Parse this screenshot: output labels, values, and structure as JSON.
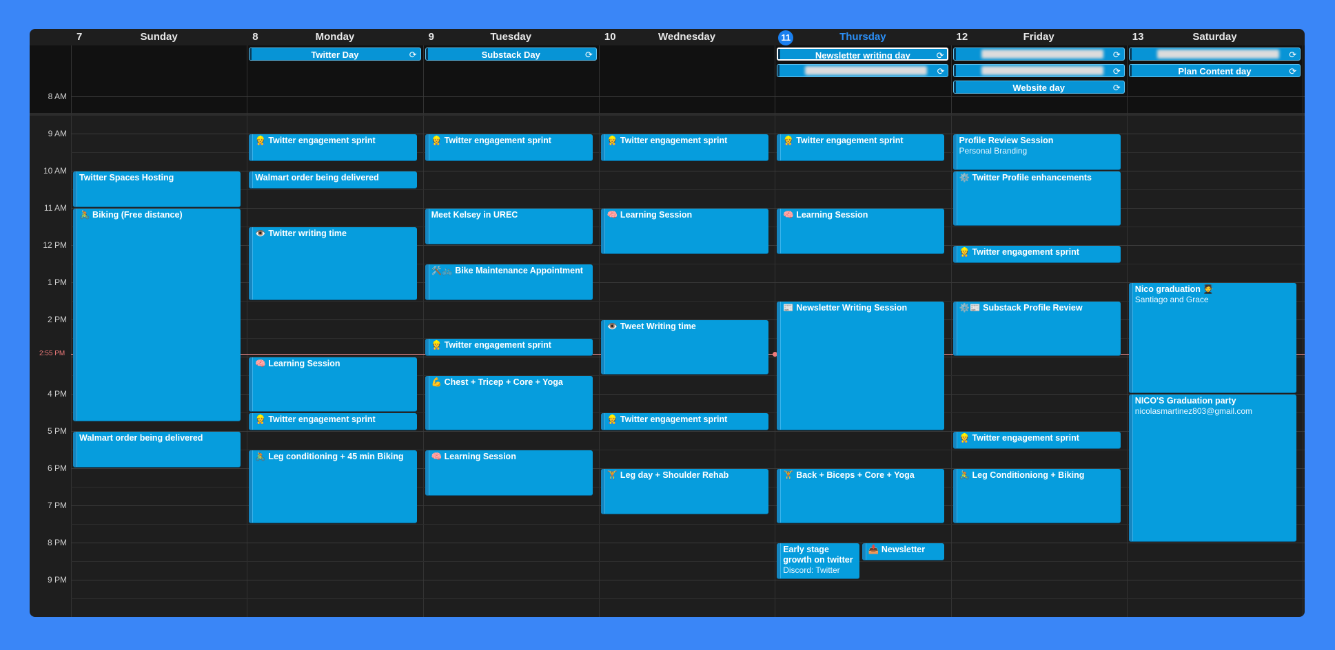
{
  "days": [
    {
      "num": "7",
      "name": "Sunday"
    },
    {
      "num": "8",
      "name": "Monday"
    },
    {
      "num": "9",
      "name": "Tuesday"
    },
    {
      "num": "10",
      "name": "Wednesday"
    },
    {
      "num": "11",
      "name": "Thursday",
      "today": true
    },
    {
      "num": "12",
      "name": "Friday"
    },
    {
      "num": "13",
      "name": "Saturday"
    }
  ],
  "hours": [
    "8 AM",
    "9 AM",
    "10 AM",
    "11 AM",
    "12 PM",
    "1 PM",
    "2 PM",
    "3 PM",
    "4 PM",
    "5 PM",
    "6 PM",
    "7 PM",
    "8 PM",
    "9 PM"
  ],
  "current_time": "2:55 PM",
  "repeat_icon": "⟳",
  "allday_events": [
    {
      "day": 1,
      "row": 0,
      "title": "Twitter Day"
    },
    {
      "day": 2,
      "row": 0,
      "title": "Substack Day"
    },
    {
      "day": 4,
      "row": 0,
      "title": "Newsletter writing day",
      "selected": true
    },
    {
      "day": 4,
      "row": 1,
      "title": "",
      "blurred": true
    },
    {
      "day": 5,
      "row": 0,
      "title": "",
      "blurred": true
    },
    {
      "day": 5,
      "row": 1,
      "title": "",
      "blurred": true
    },
    {
      "day": 5,
      "row": 2,
      "title": "Website day"
    },
    {
      "day": 6,
      "row": 0,
      "title": "",
      "blurred": true
    },
    {
      "day": 6,
      "row": 1,
      "title": "Plan Content day"
    }
  ],
  "events": [
    {
      "day": 0,
      "start": 10.0,
      "end": 11.0,
      "title": "Twitter Spaces Hosting"
    },
    {
      "day": 0,
      "start": 11.0,
      "end": 16.75,
      "title": "🚴 Biking (Free distance)"
    },
    {
      "day": 0,
      "start": 17.0,
      "end": 18.0,
      "title": "Walmart order being delivered"
    },
    {
      "day": 1,
      "start": 9.0,
      "end": 9.75,
      "title": "👷 Twitter engagement sprint"
    },
    {
      "day": 1,
      "start": 10.0,
      "end": 10.5,
      "title": "Walmart order being delivered"
    },
    {
      "day": 1,
      "start": 11.5,
      "end": 13.5,
      "title": "👁️ Twitter writing time"
    },
    {
      "day": 1,
      "start": 15.0,
      "end": 16.5,
      "title": "🧠 Learning Session"
    },
    {
      "day": 1,
      "start": 16.5,
      "end": 17.0,
      "title": "👷 Twitter engagement sprint"
    },
    {
      "day": 1,
      "start": 17.5,
      "end": 19.5,
      "title": "🚴 Leg conditioning + 45 min Biking"
    },
    {
      "day": 2,
      "start": 9.0,
      "end": 9.75,
      "title": "👷 Twitter engagement sprint"
    },
    {
      "day": 2,
      "start": 11.0,
      "end": 12.0,
      "title": "Meet Kelsey in UREC"
    },
    {
      "day": 2,
      "start": 12.5,
      "end": 13.5,
      "title": "🛠️🚲 Bike Maintenance Appointment"
    },
    {
      "day": 2,
      "start": 14.5,
      "end": 15.0,
      "title": "👷 Twitter engagement sprint"
    },
    {
      "day": 2,
      "start": 15.5,
      "end": 17.0,
      "title": "💪 Chest + Tricep + Core + Yoga"
    },
    {
      "day": 2,
      "start": 17.5,
      "end": 18.75,
      "title": "🧠 Learning Session"
    },
    {
      "day": 3,
      "start": 9.0,
      "end": 9.75,
      "title": "👷 Twitter engagement sprint"
    },
    {
      "day": 3,
      "start": 11.0,
      "end": 12.25,
      "title": "🧠 Learning Session"
    },
    {
      "day": 3,
      "start": 14.0,
      "end": 15.5,
      "title": "👁️ Tweet Writing time"
    },
    {
      "day": 3,
      "start": 16.5,
      "end": 17.0,
      "title": "👷 Twitter engagement sprint"
    },
    {
      "day": 3,
      "start": 18.0,
      "end": 19.25,
      "title": "🏋️ Leg day + Shoulder Rehab"
    },
    {
      "day": 4,
      "start": 9.0,
      "end": 9.75,
      "title": "👷 Twitter engagement sprint"
    },
    {
      "day": 4,
      "start": 11.0,
      "end": 12.25,
      "title": "🧠 Learning Session"
    },
    {
      "day": 4,
      "start": 13.5,
      "end": 17.0,
      "title": "📰 Newsletter Writing Session"
    },
    {
      "day": 4,
      "start": 18.0,
      "end": 19.5,
      "title": "🏋️ Back + Biceps + Core + Yoga"
    },
    {
      "day": 4,
      "start": 20.0,
      "end": 21.0,
      "title": "Early stage growth on twitter",
      "sub": "Discord: Twitter",
      "half": "left"
    },
    {
      "day": 4,
      "start": 20.0,
      "end": 20.5,
      "title": "📥 Newsletter",
      "half": "right"
    },
    {
      "day": 5,
      "start": 9.0,
      "end": 10.0,
      "title": "Profile Review Session",
      "sub": "Personal Branding"
    },
    {
      "day": 5,
      "start": 10.0,
      "end": 11.5,
      "title": "⚙️ Twitter Profile enhancements"
    },
    {
      "day": 5,
      "start": 12.0,
      "end": 12.5,
      "title": "👷 Twitter engagement sprint"
    },
    {
      "day": 5,
      "start": 13.5,
      "end": 15.0,
      "title": "⚙️📰 Substack Profile Review"
    },
    {
      "day": 5,
      "start": 17.0,
      "end": 17.5,
      "title": "👷 Twitter engagement sprint"
    },
    {
      "day": 5,
      "start": 18.0,
      "end": 19.5,
      "title": "🚴 Leg Conditioniong + Biking"
    },
    {
      "day": 6,
      "start": 13.0,
      "end": 16.0,
      "title": "Nico graduation 🧑‍🎓",
      "sub": "Santiago and Grace"
    },
    {
      "day": 6,
      "start": 16.0,
      "end": 20.0,
      "title": "NICO'S Graduation party",
      "sub": "nicolasmartinez803@gmail.com"
    }
  ]
}
